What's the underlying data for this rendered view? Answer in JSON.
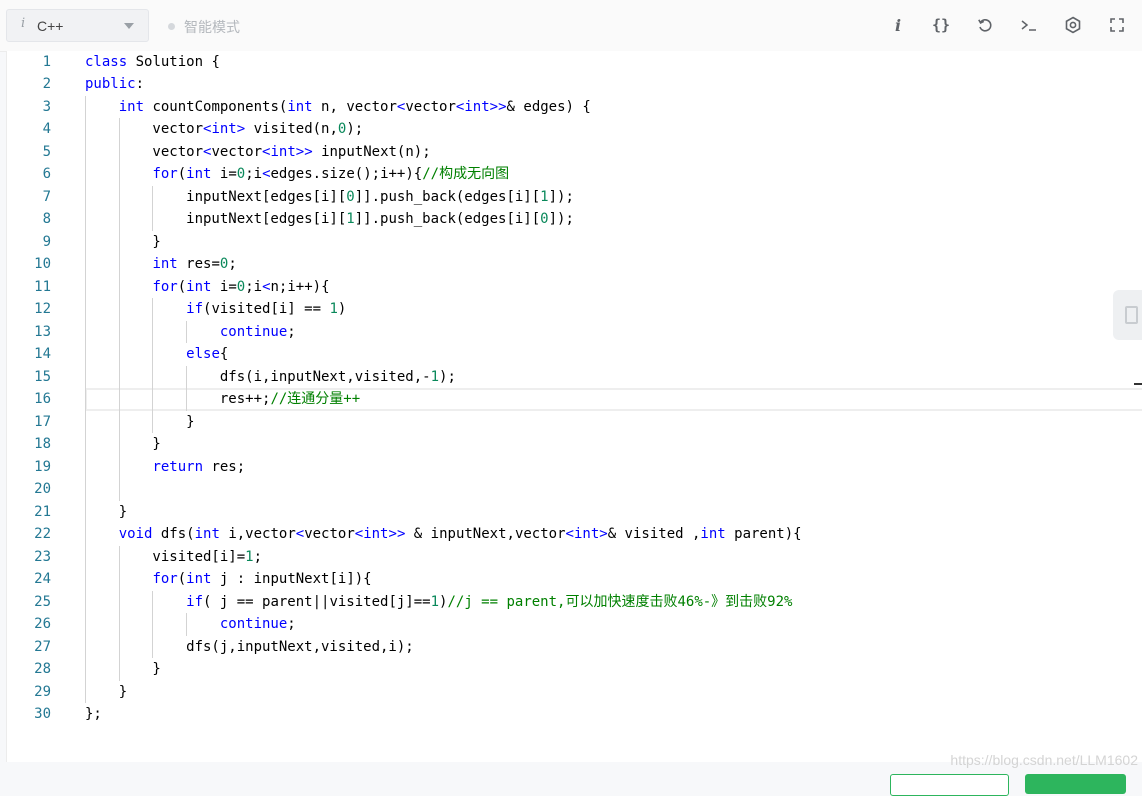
{
  "toolbar": {
    "info_glyph": "i",
    "language": "C++",
    "mode_label": "智能模式",
    "icons": [
      "info-icon",
      "code-format-icon",
      "reset-icon",
      "console-icon",
      "settings-icon",
      "fullscreen-icon"
    ],
    "braces_glyph": "{}"
  },
  "editor": {
    "current_line": 16,
    "line_numbers": [
      "1",
      "2",
      "3",
      "4",
      "5",
      "6",
      "7",
      "8",
      "9",
      "10",
      "11",
      "12",
      "13",
      "14",
      "15",
      "16",
      "17",
      "18",
      "19",
      "20",
      "21",
      "22",
      "23",
      "24",
      "25",
      "26",
      "27",
      "28",
      "29",
      "30"
    ],
    "lines": [
      "class Solution {",
      "public:",
      "    int countComponents(int n, vector<vector<int>>& edges) {",
      "        vector<int> visited(n,0);",
      "        vector<vector<int>> inputNext(n);",
      "        for(int i=0;i<edges.size();i++){//构成无向图",
      "            inputNext[edges[i][0]].push_back(edges[i][1]);",
      "            inputNext[edges[i][1]].push_back(edges[i][0]);",
      "        }",
      "        int res=0;",
      "        for(int i=0;i<n;i++){",
      "            if(visited[i] == 1)",
      "                continue;",
      "            else{",
      "                dfs(i,inputNext,visited,-1);",
      "                res++;//连通分量++",
      "            }",
      "        }",
      "        return res;",
      "",
      "    }",
      "    void dfs(int i,vector<vector<int>> & inputNext,vector<int>& visited ,int parent){",
      "        visited[i]=1;",
      "        for(int j : inputNext[i]){",
      "            if( j == parent||visited[j]==1)//j == parent,可以加快速度击败46%-》到击败92%",
      "                continue;",
      "            dfs(j,inputNext,visited,i);",
      "        }",
      "    }",
      "};"
    ]
  },
  "watermark": "https://blog.csdn.net/LLM1602",
  "colors": {
    "keyword": "#0000ff",
    "number": "#09885a",
    "comment": "#008000",
    "line_number": "#237893",
    "accent_green": "#2db55d"
  }
}
